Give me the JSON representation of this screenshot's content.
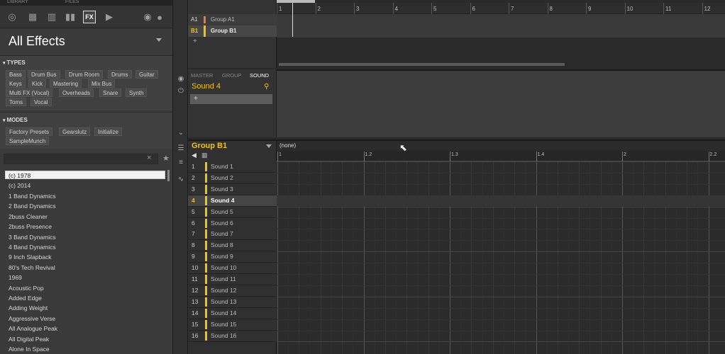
{
  "library": {
    "tabs": [
      "LIBRARY",
      "FILES"
    ],
    "title": "All Effects",
    "types_label": "TYPES",
    "types": [
      "Bass",
      "Drum Bus",
      "Drum Room",
      "Drums",
      "Guitar",
      "Keys",
      "Kick",
      "Mastering",
      "Mix Bus",
      "Multi FX (Vocal)",
      "Overheads",
      "Snare",
      "Synth",
      "Toms",
      "Vocal"
    ],
    "modes_label": "MODES",
    "modes": [
      "Factory Presets",
      "Gearslutz",
      "Initialize",
      "SampleMunch"
    ],
    "search_placeholder": "",
    "results": [
      "(c) 1978",
      "(c) 2014",
      "1 Band Dynamics",
      "2 Band Dynamics",
      "2buss Cleaner",
      "2buss Presence",
      "3 Band Dynamics",
      "4 Band Dynamics",
      "9 Inch Slapback",
      "80's Tech Revival",
      "1969",
      "Acoustic Pop",
      "Added Edge",
      "Adding Weight",
      "Aggressive Verse",
      "All Analogue Peak",
      "All Digital Peak",
      "Alone In Space"
    ]
  },
  "arranger": {
    "ruler": [
      "1",
      "2",
      "3",
      "4",
      "5",
      "6",
      "7",
      "8",
      "9",
      "10",
      "11",
      "12"
    ],
    "groups": [
      {
        "id": "A1",
        "name": "Group A1",
        "color": "#e87a3a"
      },
      {
        "id": "B1",
        "name": "Group B1",
        "color": "#f5c400"
      }
    ],
    "add": "+"
  },
  "control": {
    "tabs": [
      "MASTER",
      "GROUP",
      "SOUND"
    ],
    "selected_title": "Sound 4",
    "add": "+"
  },
  "pattern_editor": {
    "group_title": "Group B1",
    "pattern": "(none)",
    "ruler": [
      "1",
      "1.2",
      "1.3",
      "1.4",
      "2",
      "2.2"
    ],
    "sounds": [
      "Sound 1",
      "Sound 2",
      "Sound 3",
      "Sound 4",
      "Sound 5",
      "Sound 6",
      "Sound 7",
      "Sound 8",
      "Sound 9",
      "Sound 10",
      "Sound 11",
      "Sound 12",
      "Sound 13",
      "Sound 14",
      "Sound 15",
      "Sound 16"
    ],
    "selected_index": 4,
    "accent": "#f5c400"
  }
}
